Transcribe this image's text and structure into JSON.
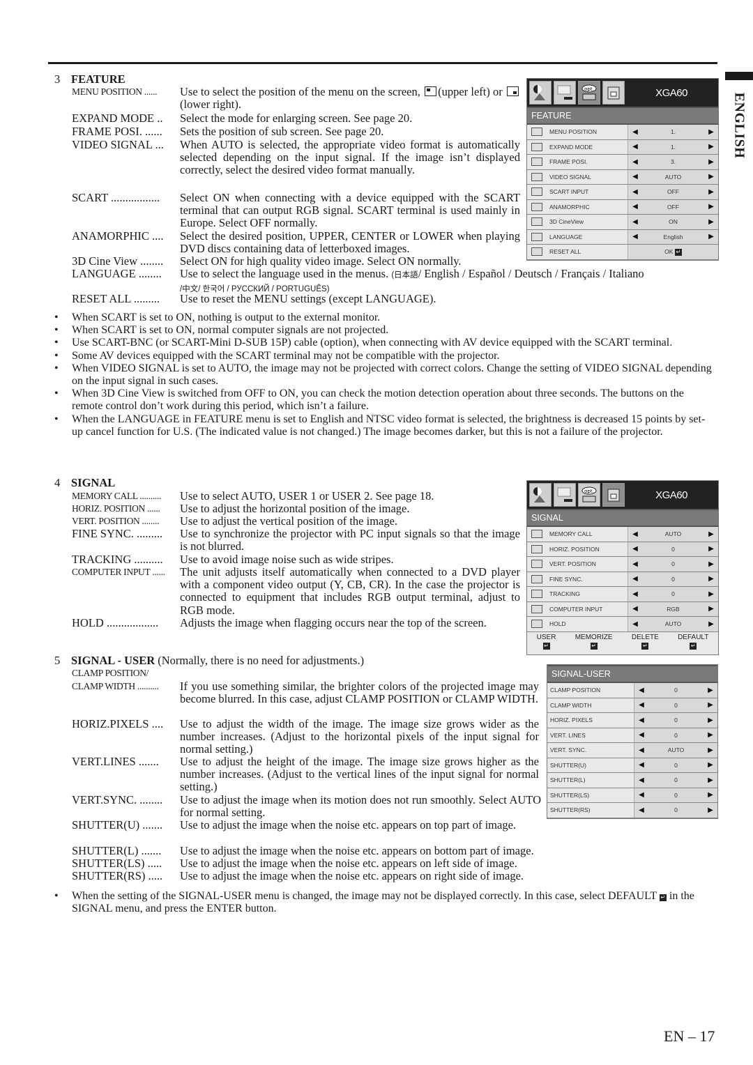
{
  "sidebar_tab": {
    "label": "ENGLISH"
  },
  "page_number": "EN – 17",
  "feature": {
    "number": "3",
    "title": "FEATURE",
    "items": [
      {
        "term": "MENU POSITION ......",
        "desc_a": "Use to select the position of the menu on the screen,",
        "desc_b": "(upper left) or",
        "desc_c": "(lower right)."
      },
      {
        "term": "EXPAND MODE ..",
        "desc": "Select the mode for enlarging screen. See page 20."
      },
      {
        "term": "FRAME POSI. ......",
        "desc": "Sets the position of sub screen. See page 20."
      },
      {
        "term": "VIDEO SIGNAL ...",
        "desc": "When AUTO is selected, the appropriate video format is automatically selected depending on the input signal. If the image isn’t displayed correctly, select the desired video format manually."
      },
      {
        "term": "SCART .................",
        "desc": "Select ON when connecting with a device equipped with the SCART terminal that can output RGB signal. SCART terminal is used mainly in Europe. Select OFF normally."
      },
      {
        "term": "ANAMORPHIC ....",
        "desc": "Select the desired position, UPPER, CENTER or LOWER when playing DVD discs containing data of letterboxed images."
      },
      {
        "term": "3D Cine View ........",
        "desc": "Select ON for high quality video image. Select ON normally."
      },
      {
        "term": "LANGUAGE ........",
        "desc": "Use to select the language used in the menus.",
        "langs_a": "(日本語",
        "langs_b": "/ English / Español / Deutsch / Français / Italiano",
        "langs_c": "/中文/ 한국어 / РУССКИЙ / PORTUGUÊS)"
      },
      {
        "term": "RESET ALL .........",
        "desc": "Use to reset the MENU settings (except LANGUAGE)."
      }
    ],
    "notes": [
      "When SCART is set to ON, nothing is output to the external monitor.",
      "When SCART is set to ON, normal computer signals are not projected.",
      "Use SCART-BNC (or SCART-Mini D-SUB 15P) cable (option), when connecting with AV device equipped with the SCART terminal.",
      "Some AV devices equipped with the SCART terminal may not be compatible with the projector.",
      "When VIDEO SIGNAL is set to AUTO, the image may not be projected with correct colors. Change the setting of VIDEO SIGNAL depending on the input signal in such cases.",
      "When 3D Cine View is switched from OFF to ON, you can check the motion detection operation about three seconds. The buttons on the remote control don’t work during this period, which isn’t a failure.",
      "When the LANGUAGE in FEATURE menu is set to English and NTSC video format is selected, the brightness is decreased 15 points by set-up cancel function for U.S. (The indicated value is not changed.) The image becomes darker, but this is not a failure of the projector."
    ],
    "menu": {
      "model": "XGA60",
      "tab_opt_label": "opt.",
      "title": "FEATURE",
      "rows": [
        {
          "label": "MENU POSITION",
          "value": "1."
        },
        {
          "label": "EXPAND MODE",
          "value": "1."
        },
        {
          "label": "FRAME POSI.",
          "value": "3."
        },
        {
          "label": "VIDEO SIGNAL",
          "value": "AUTO"
        },
        {
          "label": "SCART INPUT",
          "value": "OFF"
        },
        {
          "label": "ANAMORPHIC",
          "value": "OFF"
        },
        {
          "label": "3D CineView",
          "value": "ON"
        },
        {
          "label": "LANGUAGE",
          "value": "English"
        },
        {
          "label": "RESET ALL",
          "value": "OK"
        }
      ]
    }
  },
  "signal": {
    "number": "4",
    "title": "SIGNAL",
    "items": [
      {
        "term": "MEMORY CALL ..........",
        "desc": "Use to select AUTO, USER 1 or USER 2. See page 18."
      },
      {
        "term": "HORIZ. POSITION ......",
        "desc": "Use to adjust the horizontal position of the image."
      },
      {
        "term": "VERT. POSITION ........",
        "desc": "Use to adjust the vertical position of the image."
      },
      {
        "term": "FINE SYNC. .........",
        "desc": "Use to synchronize the projector with PC input signals so that the image is not blurred."
      },
      {
        "term": "TRACKING ..........",
        "desc": "Use to avoid image noise such as wide stripes."
      },
      {
        "term": "COMPUTER INPUT ......",
        "desc": "The unit adjusts itself automatically when connected to a DVD player with a component video output (Y, CB, CR). In the case the projector is connected to equipment that includes RGB output terminal, adjust to RGB mode."
      },
      {
        "term": "HOLD ..................",
        "desc": "Adjusts the image when flagging occurs near the top of the screen."
      }
    ],
    "menu": {
      "model": "XGA60",
      "tab_opt_label": "opt.",
      "title": "SIGNAL",
      "rows": [
        {
          "label": "MEMORY CALL",
          "value": "AUTO"
        },
        {
          "label": "HORIZ. POSITION",
          "value": "0"
        },
        {
          "label": "VERT. POSITION",
          "value": "0"
        },
        {
          "label": "FINE SYNC.",
          "value": "0"
        },
        {
          "label": "TRACKING",
          "value": "0"
        },
        {
          "label": "COMPUTER INPUT",
          "value": "RGB"
        },
        {
          "label": "HOLD",
          "value": "AUTO"
        }
      ],
      "buttons": [
        "USER",
        "MEMORIZE",
        "DELETE",
        "DEFAULT"
      ]
    }
  },
  "signal_user": {
    "number": "5",
    "title": "SIGNAL  - USER",
    "subtitle": "(Normally, there is no need for adjustments.)",
    "items": [
      {
        "term": "CLAMP POSITION/",
        "term2": "CLAMP WIDTH ..........",
        "desc": "If you use something similar, the brighter colors of the projected image may become blurred. In this case, adjust CLAMP POSITION or CLAMP WIDTH."
      },
      {
        "term": "HORIZ.PIXELS ....",
        "desc": "Use to adjust the width of the image.  The image size grows wider as the number increases.  (Adjust to the horizontal pixels of the input signal for normal setting.)"
      },
      {
        "term": "VERT.LINES .......",
        "desc": "Use to adjust the height of the image.  The image size grows higher as the number increases.  (Adjust to the vertical lines of the input signal for normal setting.)"
      },
      {
        "term": "VERT.SYNC. ........",
        "desc": "Use to adjust the image when its motion does not run smoothly. Select AUTO for normal setting."
      },
      {
        "term": "SHUTTER(U) .......",
        "desc": "Use to adjust the image when the noise etc. appears on top part of image."
      },
      {
        "term": "SHUTTER(L) .......",
        "desc": "Use to adjust the image when the noise etc. appears on bottom part of image."
      },
      {
        "term": "SHUTTER(LS) .....",
        "desc": "Use to adjust the image when the noise etc. appears on left side of image."
      },
      {
        "term": "SHUTTER(RS) .....",
        "desc": "Use to adjust the image when the noise etc. appears on right side of image."
      }
    ],
    "note_a": "When the setting of the SIGNAL-USER menu is changed, the image may not be displayed correctly. In this case, select DEFAULT",
    "note_b": "in the SIGNAL menu, and press the ENTER button.",
    "menu": {
      "title": "SIGNAL-USER",
      "rows": [
        {
          "label": "CLAMP POSITION",
          "value": "0"
        },
        {
          "label": "CLAMP WIDTH",
          "value": "0"
        },
        {
          "label": "HORIZ. PIXELS",
          "value": "0"
        },
        {
          "label": "VERT. LINES",
          "value": "0"
        },
        {
          "label": "VERT. SYNC.",
          "value": "AUTO"
        },
        {
          "label": "SHUTTER(U)",
          "value": "0"
        },
        {
          "label": "SHUTTER(L)",
          "value": "0"
        },
        {
          "label": "SHUTTER(LS)",
          "value": "0"
        },
        {
          "label": "SHUTTER(RS)",
          "value": "0"
        }
      ]
    }
  }
}
